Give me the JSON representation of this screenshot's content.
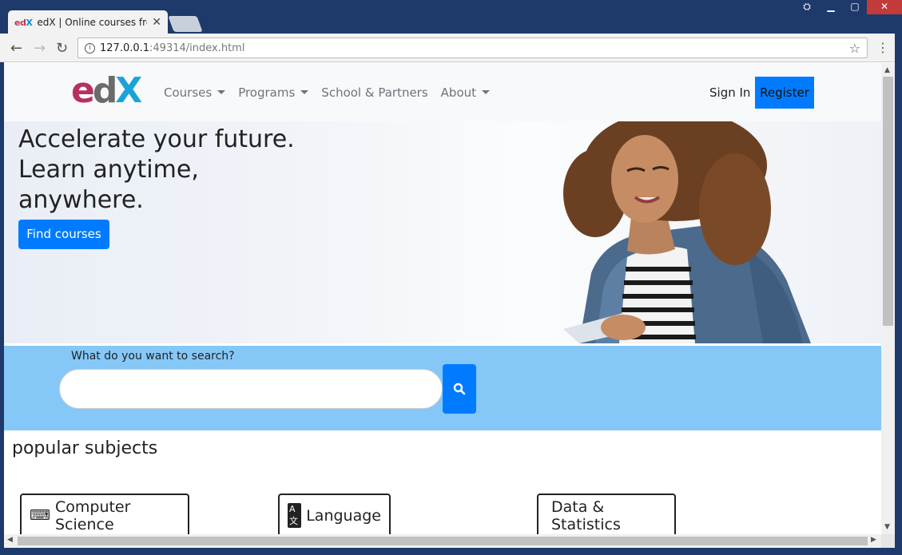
{
  "browser": {
    "tab_title": "edX | Online courses from",
    "favicon_e": "ed",
    "favicon_x": "X",
    "tab_close": "✕",
    "url_host": "127.0.0.1",
    "url_rest": ":49314/index.html"
  },
  "navbar": {
    "logo_e": "e",
    "logo_d": "d",
    "logo_x": "X",
    "links": [
      "Courses",
      "Programs",
      "School & Partners",
      "About"
    ],
    "sign_in": "Sign In",
    "register": "Register"
  },
  "hero": {
    "title": "Accelerate your future. Learn anytime, anywhere.",
    "cta": "Find courses"
  },
  "search": {
    "label": "What do you want to search?",
    "placeholder": ""
  },
  "popular": {
    "heading": "popular subjects",
    "subjects": [
      {
        "label": "Computer Science",
        "icon": "keyboard-icon"
      },
      {
        "label": "Language",
        "icon": "language-icon"
      },
      {
        "label": "Data & Statistics",
        "icon": ""
      }
    ]
  },
  "colors": {
    "primary": "#007bff",
    "search_band": "#85c8f8",
    "navbar_bg": "#f8f9fa"
  }
}
